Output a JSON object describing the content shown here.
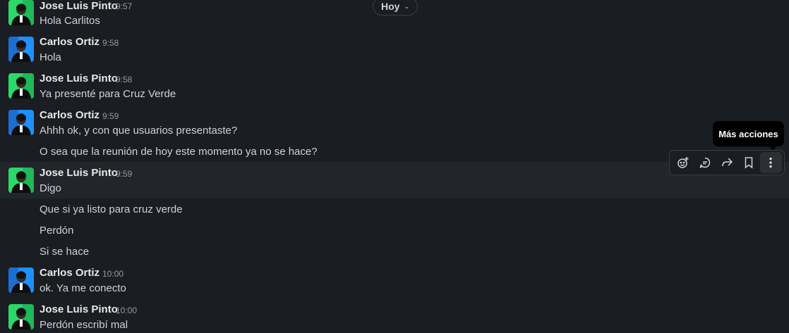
{
  "day_divider": {
    "label": "Hoy",
    "chevron_icon": "chevron-down-icon"
  },
  "messages": [
    {
      "author": "Jose Luis Pinto",
      "time": "9:57",
      "lines": [
        "Hola Carlitos"
      ]
    },
    {
      "author": "Carlos Ortiz",
      "time": "9:58",
      "lines": [
        "Hola"
      ]
    },
    {
      "author": "Jose Luis Pinto",
      "time": "9:58",
      "lines": [
        "Ya presenté para Cruz Verde"
      ]
    },
    {
      "author": "Carlos Ortiz",
      "time": "9:59",
      "lines": [
        "Ahhh ok, y con que usuarios presentaste?",
        "O sea que la reunión de hoy este momento ya no se hace?"
      ]
    },
    {
      "author": "Jose Luis Pinto",
      "time": "9:59",
      "lines": [
        "Digo",
        "Que si ya listo para cruz verde",
        "Perdón",
        "Si se hace"
      ]
    },
    {
      "author": "Carlos Ortiz",
      "time": "10:00",
      "lines": [
        "ok. Ya me conecto"
      ]
    },
    {
      "author": "Jose Luis Pinto",
      "time": "10:00",
      "lines": [
        "Perdón escribí mal"
      ]
    }
  ],
  "message_actions": {
    "tooltip": "Más acciones",
    "icons": [
      "add-reaction-icon",
      "reply-thread-icon",
      "forward-icon",
      "bookmark-icon",
      "more-actions-icon"
    ]
  },
  "colors": {
    "background": "#1a1d21",
    "hover_row": "#222529",
    "avatar_green": "#2bd96b",
    "avatar_blue": "#1e90ff"
  }
}
